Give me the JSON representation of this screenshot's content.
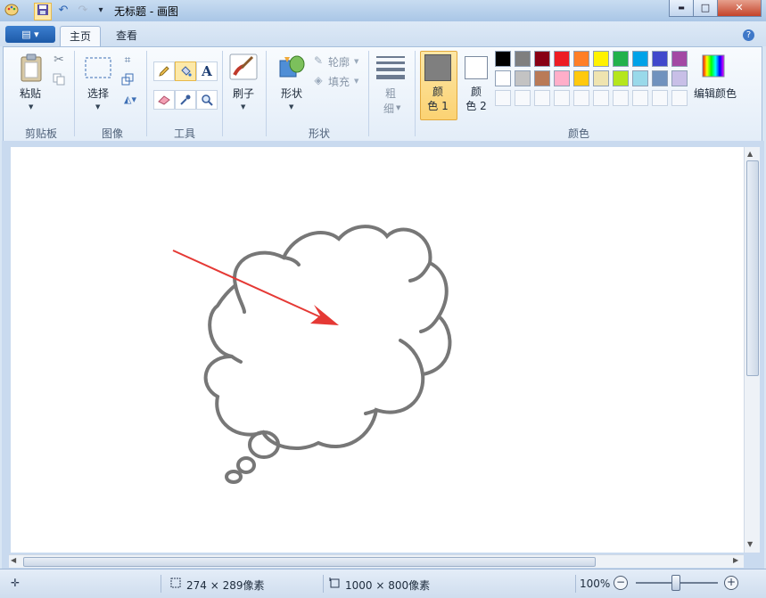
{
  "window": {
    "title": "无标题 - 画图",
    "controls": {
      "minimize": "▬",
      "maximize": "□",
      "close": "✕"
    }
  },
  "quick_access": {
    "save_icon": "floppy-disk",
    "undo_icon": "undo-arrow",
    "redo_icon": "redo-arrow",
    "customize": "▾"
  },
  "tabs": [
    {
      "label": "主页",
      "active": true
    },
    {
      "label": "查看",
      "active": false
    }
  ],
  "help_glyph": "?",
  "ribbon": {
    "clipboard": {
      "group_label": "剪贴板",
      "paste_label": "粘贴"
    },
    "image": {
      "group_label": "图像",
      "select_label": "选择"
    },
    "tools": {
      "group_label": "工具",
      "text_tool_glyph": "A"
    },
    "brushes": {
      "label": "刷子"
    },
    "shapes": {
      "group_label": "形状",
      "shapes_label": "形状",
      "outline_label": "轮廓",
      "fill_label": "填充"
    },
    "size": {
      "line1": "粗",
      "line2": "细"
    },
    "colors": {
      "group_label": "颜色",
      "color1": {
        "line1": "颜",
        "line2": "色 1",
        "value": "#7f7f7f"
      },
      "color2": {
        "line1": "颜",
        "line2": "色 2",
        "value": "#ffffff"
      },
      "edit_colors_label": "编辑颜色",
      "palette_row1": [
        "#000000",
        "#7f7f7f",
        "#880015",
        "#ed1c24",
        "#ff7f27",
        "#fff200",
        "#22b14c",
        "#00a2e8",
        "#3f48cc",
        "#a349a4"
      ],
      "palette_row2": [
        "#ffffff",
        "#c3c3c3",
        "#b97a57",
        "#ffaec9",
        "#ffc90e",
        "#efe4b0",
        "#b5e61d",
        "#99d9ea",
        "#7092be",
        "#c8bfe7"
      ]
    }
  },
  "canvas": {
    "drawing": "thought-bubble with red arrow",
    "stroke_color": "#777777",
    "arrow_color": "#e53935"
  },
  "status": {
    "selection_size": "274 × 289像素",
    "image_size": "1000 × 800像素",
    "zoom": "100%"
  }
}
